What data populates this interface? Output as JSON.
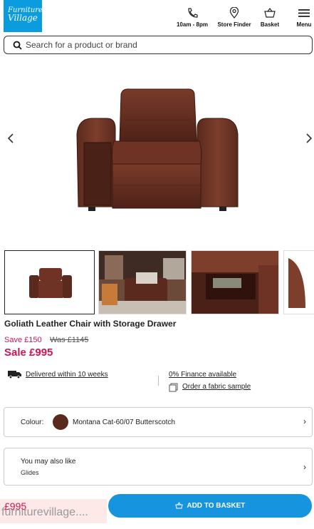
{
  "header": {
    "logo_line1": "Furniture",
    "logo_line2": "Village",
    "hours_label": "10am - 8pm",
    "store_finder_label": "Store Finder",
    "basket_label": "Basket",
    "menu_label": "Menu",
    "icons": [
      "phone-icon",
      "location-pin-icon",
      "basket-icon",
      "hamburger-menu-icon"
    ]
  },
  "search": {
    "placeholder": "Search for a product or brand",
    "icon": "search-icon"
  },
  "product": {
    "title": "Goliath Leather Chair with Storage Drawer",
    "save_text": "Save £150",
    "was_text": "Was £1145",
    "sale_text": "Sale £995",
    "sale_color": "#d11550"
  },
  "delivery": {
    "delivery_text": "Delivered within 10 weeks",
    "finance_text": "0% Finance available",
    "sample_text": "Order a fabric sample"
  },
  "colour": {
    "label": "Colour:",
    "value": "Montana Cat-60/07 Butterscotch",
    "swatch_color": "#5a2a1e"
  },
  "also_like": {
    "title": "You may also like",
    "subtitle": "Glides"
  },
  "footer": {
    "price": "£995",
    "url": "furniturevillage....",
    "add_to_basket": "ADD TO BASKET",
    "accent": "#1694dd"
  }
}
